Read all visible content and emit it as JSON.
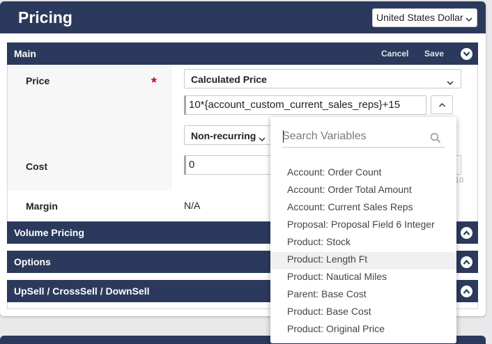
{
  "header": {
    "title": "Pricing",
    "currency": "United States Dollar"
  },
  "main": {
    "label": "Main",
    "cancel": "Cancel",
    "save": "Save",
    "price": {
      "label": "Price",
      "required_mark": "*",
      "mode": "Calculated Price",
      "formula": "10*{account_custom_current_sales_reps}+15",
      "recurrence": "Non-recurring"
    },
    "cost": {
      "label": "Cost",
      "value": "0",
      "hint": "10"
    },
    "margin": {
      "label": "Margin",
      "value": "N/A"
    }
  },
  "sections": [
    {
      "label": "Volume Pricing"
    },
    {
      "label": "Options"
    },
    {
      "label": "UpSell / CrossSell / DownSell"
    }
  ],
  "variables": {
    "search_placeholder": "Search Variables",
    "hovered_index": 5,
    "items": [
      "Account: Order Count",
      "Account: Order Total Amount",
      "Account: Current Sales Reps",
      "Proposal: Proposal Field 6 Integer",
      "Product: Stock",
      "Product: Length Ft",
      "Product: Nautical Miles",
      "Parent: Base Cost",
      "Product: Base Cost",
      "Product: Original Price"
    ]
  },
  "colors": {
    "header_bg": "#2b3a5c",
    "required": "#d0021b"
  },
  "icons": {
    "currency_dropdown": "chevron-down-icon",
    "section_toggle_collapse": "chevron-down-circle-icon",
    "section_toggle_expand": "chevron-up-circle-icon",
    "formula_toggle": "chevron-up-icon",
    "search": "search-icon"
  }
}
